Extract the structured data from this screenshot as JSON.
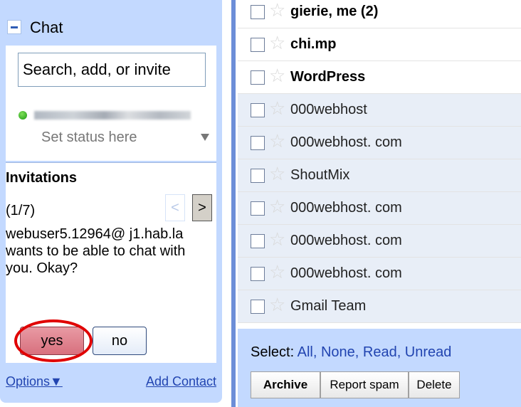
{
  "chat": {
    "title": "Chat",
    "search_placeholder": "Search, add, or invite",
    "status_text": "Set status here",
    "invitations": {
      "heading": "Invitations",
      "count": "(1/7)",
      "prev": "<",
      "next": ">",
      "message": "webuser5.12964@ j1.hab.la wants to be able to chat with you. Okay?",
      "yes_label": "yes",
      "no_label": "no"
    },
    "footer": {
      "options_label": "Options▼",
      "add_contact_label": "Add Contact"
    }
  },
  "mail": {
    "rows": [
      {
        "sender": "gierie, me (2)",
        "unread": true
      },
      {
        "sender": "chi.mp",
        "unread": true
      },
      {
        "sender": "WordPress",
        "unread": true
      },
      {
        "sender": "000webhost",
        "unread": false
      },
      {
        "sender": "000webhost. com",
        "unread": false
      },
      {
        "sender": "ShoutMix",
        "unread": false
      },
      {
        "sender": "000webhost. com",
        "unread": false
      },
      {
        "sender": "000webhost. com",
        "unread": false
      },
      {
        "sender": "000webhost. com",
        "unread": false
      },
      {
        "sender": "Gmail Team",
        "unread": false
      }
    ],
    "select_label": "Select:",
    "select_links": "All, None, Read, Unread",
    "archive_label": "Archive",
    "spam_label": "Report spam",
    "delete_label": "Delete"
  },
  "colors": {
    "chat_panel_bg": "#c3d9ff",
    "read_row_bg": "#e8eef7",
    "link_blue": "#2144b0",
    "yes_highlight": "#e00000"
  }
}
